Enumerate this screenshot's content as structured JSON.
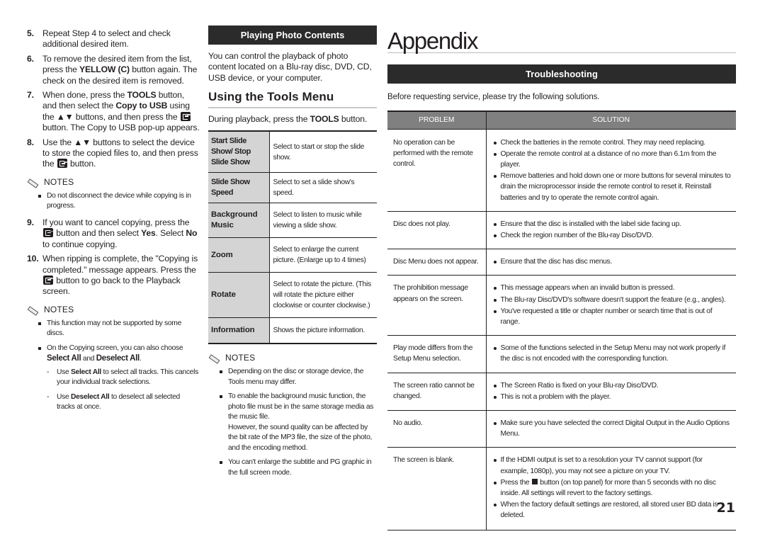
{
  "col1": {
    "steps": [
      {
        "num": "5.",
        "parts": [
          "Repeat Step 4 to select and check additional desired item."
        ]
      },
      {
        "num": "6.",
        "pre": "To remove the desired item from the list, press the ",
        "bold": "YELLOW (C)",
        "post": " button again. The check on the desired item is removed."
      },
      {
        "num": "7.",
        "pre": "When done, press the ",
        "bold1": "TOOLS",
        "mid1": " button, and then select the ",
        "bold2": "Copy to USB",
        "mid2": " using the ▲▼ buttons, and then press the ",
        "post": " button. The Copy to USB pop-up appears."
      },
      {
        "num": "8.",
        "pre": "Use the ▲▼ buttons to select the device to store the copied files to, and then press the ",
        "post": " button."
      },
      {
        "num": "9.",
        "pre": "If you want to cancel copying, press the ",
        "mid1": " button and then select ",
        "bold1": "Yes",
        "mid2": ". Select ",
        "bold2": "No",
        "post": " to continue copying."
      },
      {
        "num": "10.",
        "pre": "When ripping is complete, the \"Copying is completed.\" message appears. Press the ",
        "post": " button to go back to the Playback screen."
      }
    ],
    "notes1": {
      "title": "NOTES",
      "items": [
        "Do not disconnect the device while copying is in progress."
      ]
    },
    "notes2": {
      "title": "NOTES",
      "item1": "This function may not be supported by some discs.",
      "item2_pre": "On the Copying screen, you can also choose ",
      "item2_b1": "Select All",
      "item2_mid": " and ",
      "item2_b2": "Deselect All",
      "item2_post": ".",
      "sub1_pre": "Use ",
      "sub1_b": "Select All",
      "sub1_post": " to select all tracks. This cancels your individual track selections.",
      "sub2_pre": "Use ",
      "sub2_b": "Deselect All",
      "sub2_post": " to deselect all selected tracks at once."
    }
  },
  "col2": {
    "band": "Playing Photo Contents",
    "intro": "You can control the playback of photo content located on a Blu-ray disc, DVD, CD, USB device, or your computer.",
    "section_title": "Using the Tools Menu",
    "during_pre": "During playback, press the ",
    "during_bold": "TOOLS",
    "during_post": " button.",
    "tools": [
      {
        "key": "Start Slide Show/ Stop Slide Show",
        "value": "Select to start or stop the slide show."
      },
      {
        "key": "Slide Show Speed",
        "value": "Select to set a slide show's speed."
      },
      {
        "key": "Background Music",
        "value": "Select to listen to music while viewing a slide show."
      },
      {
        "key": "Zoom",
        "value": "Select to enlarge the current picture. (Enlarge up to 4 times)"
      },
      {
        "key": "Rotate",
        "value": "Select to rotate the picture. (This will rotate the picture either clockwise or counter clockwise.)"
      },
      {
        "key": "Information",
        "value": "Shows the picture information."
      }
    ],
    "notes": {
      "title": "NOTES",
      "items": [
        "Depending on the disc or storage device, the Tools menu may differ.",
        "To enable the background music function, the photo file must be in the same storage media as the music file.",
        "However, the sound quality can be affected by the bit rate of the MP3 file, the size of the photo, and the encoding method.",
        "You can't enlarge the subtitle and PG graphic in the full screen mode."
      ]
    }
  },
  "col3": {
    "title": "Appendix",
    "band": "Troubleshooting",
    "intro": "Before requesting service, please try the following solutions.",
    "headers": {
      "problem": "PROBLEM",
      "solution": "SOLUTION"
    },
    "rows": [
      {
        "problem": "No operation can be performed with the remote control.",
        "solutions": [
          "Check the batteries in the remote control. They may need replacing.",
          "Operate the remote control at a distance of no more than 6.1m from the player.",
          "Remove batteries and hold down one or more buttons for several minutes to drain the microprocessor inside the remote control to reset it. Reinstall batteries and try to operate the remote control again."
        ]
      },
      {
        "problem": "Disc does not play.",
        "solutions": [
          "Ensure that the disc is installed with the label side facing up.",
          "Check the region number of the Blu-ray Disc/DVD."
        ]
      },
      {
        "problem": "Disc Menu does not appear.",
        "solutions": [
          "Ensure that the disc has disc menus."
        ]
      },
      {
        "problem": "The prohibition message appears on the screen.",
        "solutions": [
          "This message appears when an invalid button is pressed.",
          "The Blu-ray Disc/DVD's software doesn't support the feature (e.g., angles).",
          "You've requested a title or chapter number or search time that is out of range."
        ]
      },
      {
        "problem": "Play mode differs from the Setup Menu selection.",
        "solutions": [
          "Some of the functions selected in the Setup Menu may not work properly if the disc is not encoded with the corresponding function."
        ]
      },
      {
        "problem": "The screen ratio cannot be changed.",
        "solutions": [
          "The Screen Ratio is fixed on your Blu-ray Disc/DVD.",
          "This is not a problem with the player."
        ]
      },
      {
        "problem": "No audio.",
        "solutions": [
          "Make sure you have selected the correct Digital Output in the Audio Options Menu."
        ]
      },
      {
        "problem": "The screen is blank.",
        "solutions": [
          "If the HDMI output is set to a resolution your TV cannot support (for example, 1080p), you may not see a picture on your TV.",
          "__STOP__",
          "When the factory default settings are restored, all stored user BD data is deleted."
        ]
      }
    ],
    "stop_pre": "Press the ",
    "stop_post": " button (on top panel) for more than 5 seconds with no disc inside. All settings will revert to the factory settings."
  },
  "page_number": "21"
}
